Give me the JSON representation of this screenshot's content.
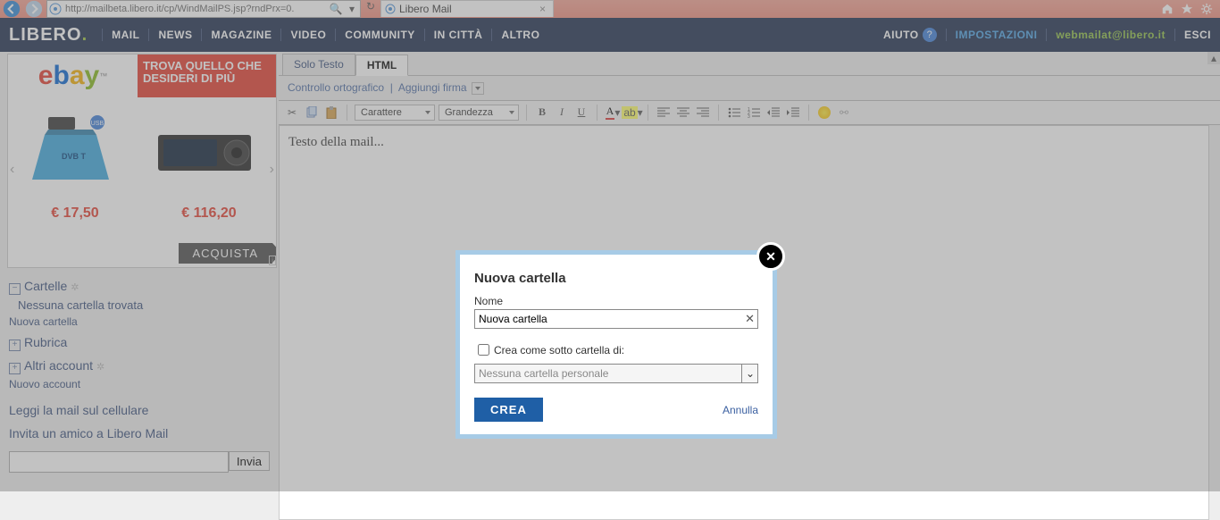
{
  "browser": {
    "url": "http://mailbeta.libero.it/cp/WindMailPS.jsp?rndPrx=0.",
    "tab_title": "Libero Mail"
  },
  "header": {
    "logo": "LIBERO",
    "nav": [
      "MAIL",
      "NEWS",
      "MAGAZINE",
      "VIDEO",
      "COMMUNITY",
      "IN CITTÀ",
      "ALTRO"
    ],
    "help": "AIUTO",
    "settings": "IMPOSTAZIONI",
    "email": "webmailat@libero.it",
    "exit": "ESCI"
  },
  "ad": {
    "slogan": "TROVA QUELLO CHE DESIDERI DI PIÙ",
    "price1": "€ 17,50",
    "price2": "€ 116,20",
    "buy": "ACQUISTA"
  },
  "sidebar": {
    "folders_h": "Cartelle",
    "no_folder": "Nessuna cartella trovata",
    "new_folder": "Nuova cartella",
    "rubrica_h": "Rubrica",
    "accounts_h": "Altri account",
    "new_account": "Nuovo account",
    "read_mobile": "Leggi la mail sul cellulare",
    "invite": "Invita un amico a Libero Mail",
    "invite_btn": "Invia"
  },
  "compose": {
    "tab_text": "Solo Testo",
    "tab_html": "HTML",
    "spellcheck": "Controllo ortografico",
    "add_sig": "Aggiungi firma",
    "font_sel": "Carattere",
    "size_sel": "Grandezza",
    "placeholder": "Testo della mail..."
  },
  "dialog": {
    "title": "Nuova cartella",
    "name_label": "Nome",
    "name_value": "Nuova cartella",
    "sub_label": "Crea come sotto cartella di:",
    "sub_select": "Nessuna cartella personale",
    "create": "CREA",
    "cancel": "Annulla"
  }
}
